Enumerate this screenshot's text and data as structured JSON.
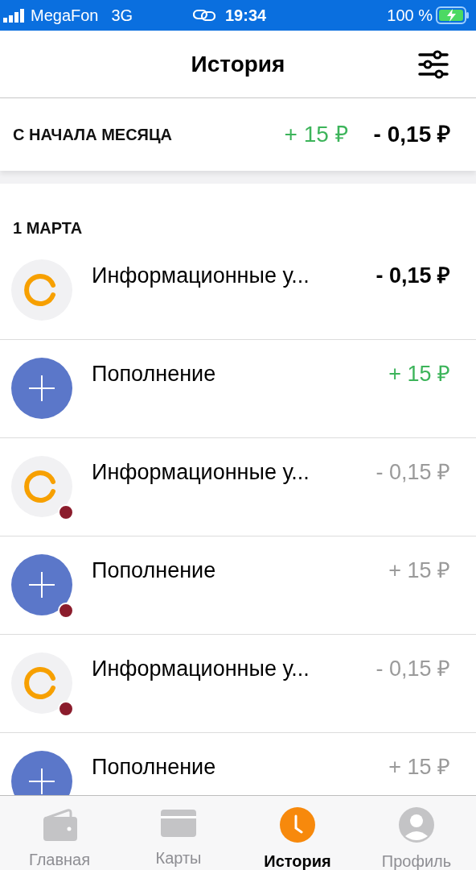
{
  "status_bar": {
    "carrier": "MegaFon",
    "network": "3G",
    "time": "19:34",
    "battery": "100 %"
  },
  "header": {
    "title": "История"
  },
  "summary": {
    "label": "С НАЧАЛА МЕСЯЦА",
    "income": "+ 15 ₽",
    "expense": "- 0,15 ₽"
  },
  "section": {
    "date": "1 МАРТА"
  },
  "transactions": [
    {
      "kind": "service",
      "title": "Информационные у...",
      "amount": "- 0,15 ₽",
      "pending": false,
      "badge": false
    },
    {
      "kind": "topup",
      "title": "Пополнение",
      "amount": "+ 15 ₽",
      "pending": false,
      "badge": false
    },
    {
      "kind": "service",
      "title": "Информационные у...",
      "amount": "- 0,15 ₽",
      "pending": true,
      "badge": true
    },
    {
      "kind": "topup",
      "title": "Пополнение",
      "amount": "+ 15 ₽",
      "pending": true,
      "badge": true
    },
    {
      "kind": "service",
      "title": "Информационные у...",
      "amount": "- 0,15 ₽",
      "pending": true,
      "badge": true
    },
    {
      "kind": "topup",
      "title": "Пополнение",
      "amount": "+ 15 ₽",
      "pending": true,
      "badge": false
    }
  ],
  "tab_bar": [
    {
      "kind": "wallet",
      "label": "Главная",
      "selected": false
    },
    {
      "kind": "card",
      "label": "Карты",
      "selected": false
    },
    {
      "kind": "clock",
      "label": "История",
      "selected": true
    },
    {
      "kind": "profile",
      "label": "Профиль",
      "selected": false
    }
  ]
}
